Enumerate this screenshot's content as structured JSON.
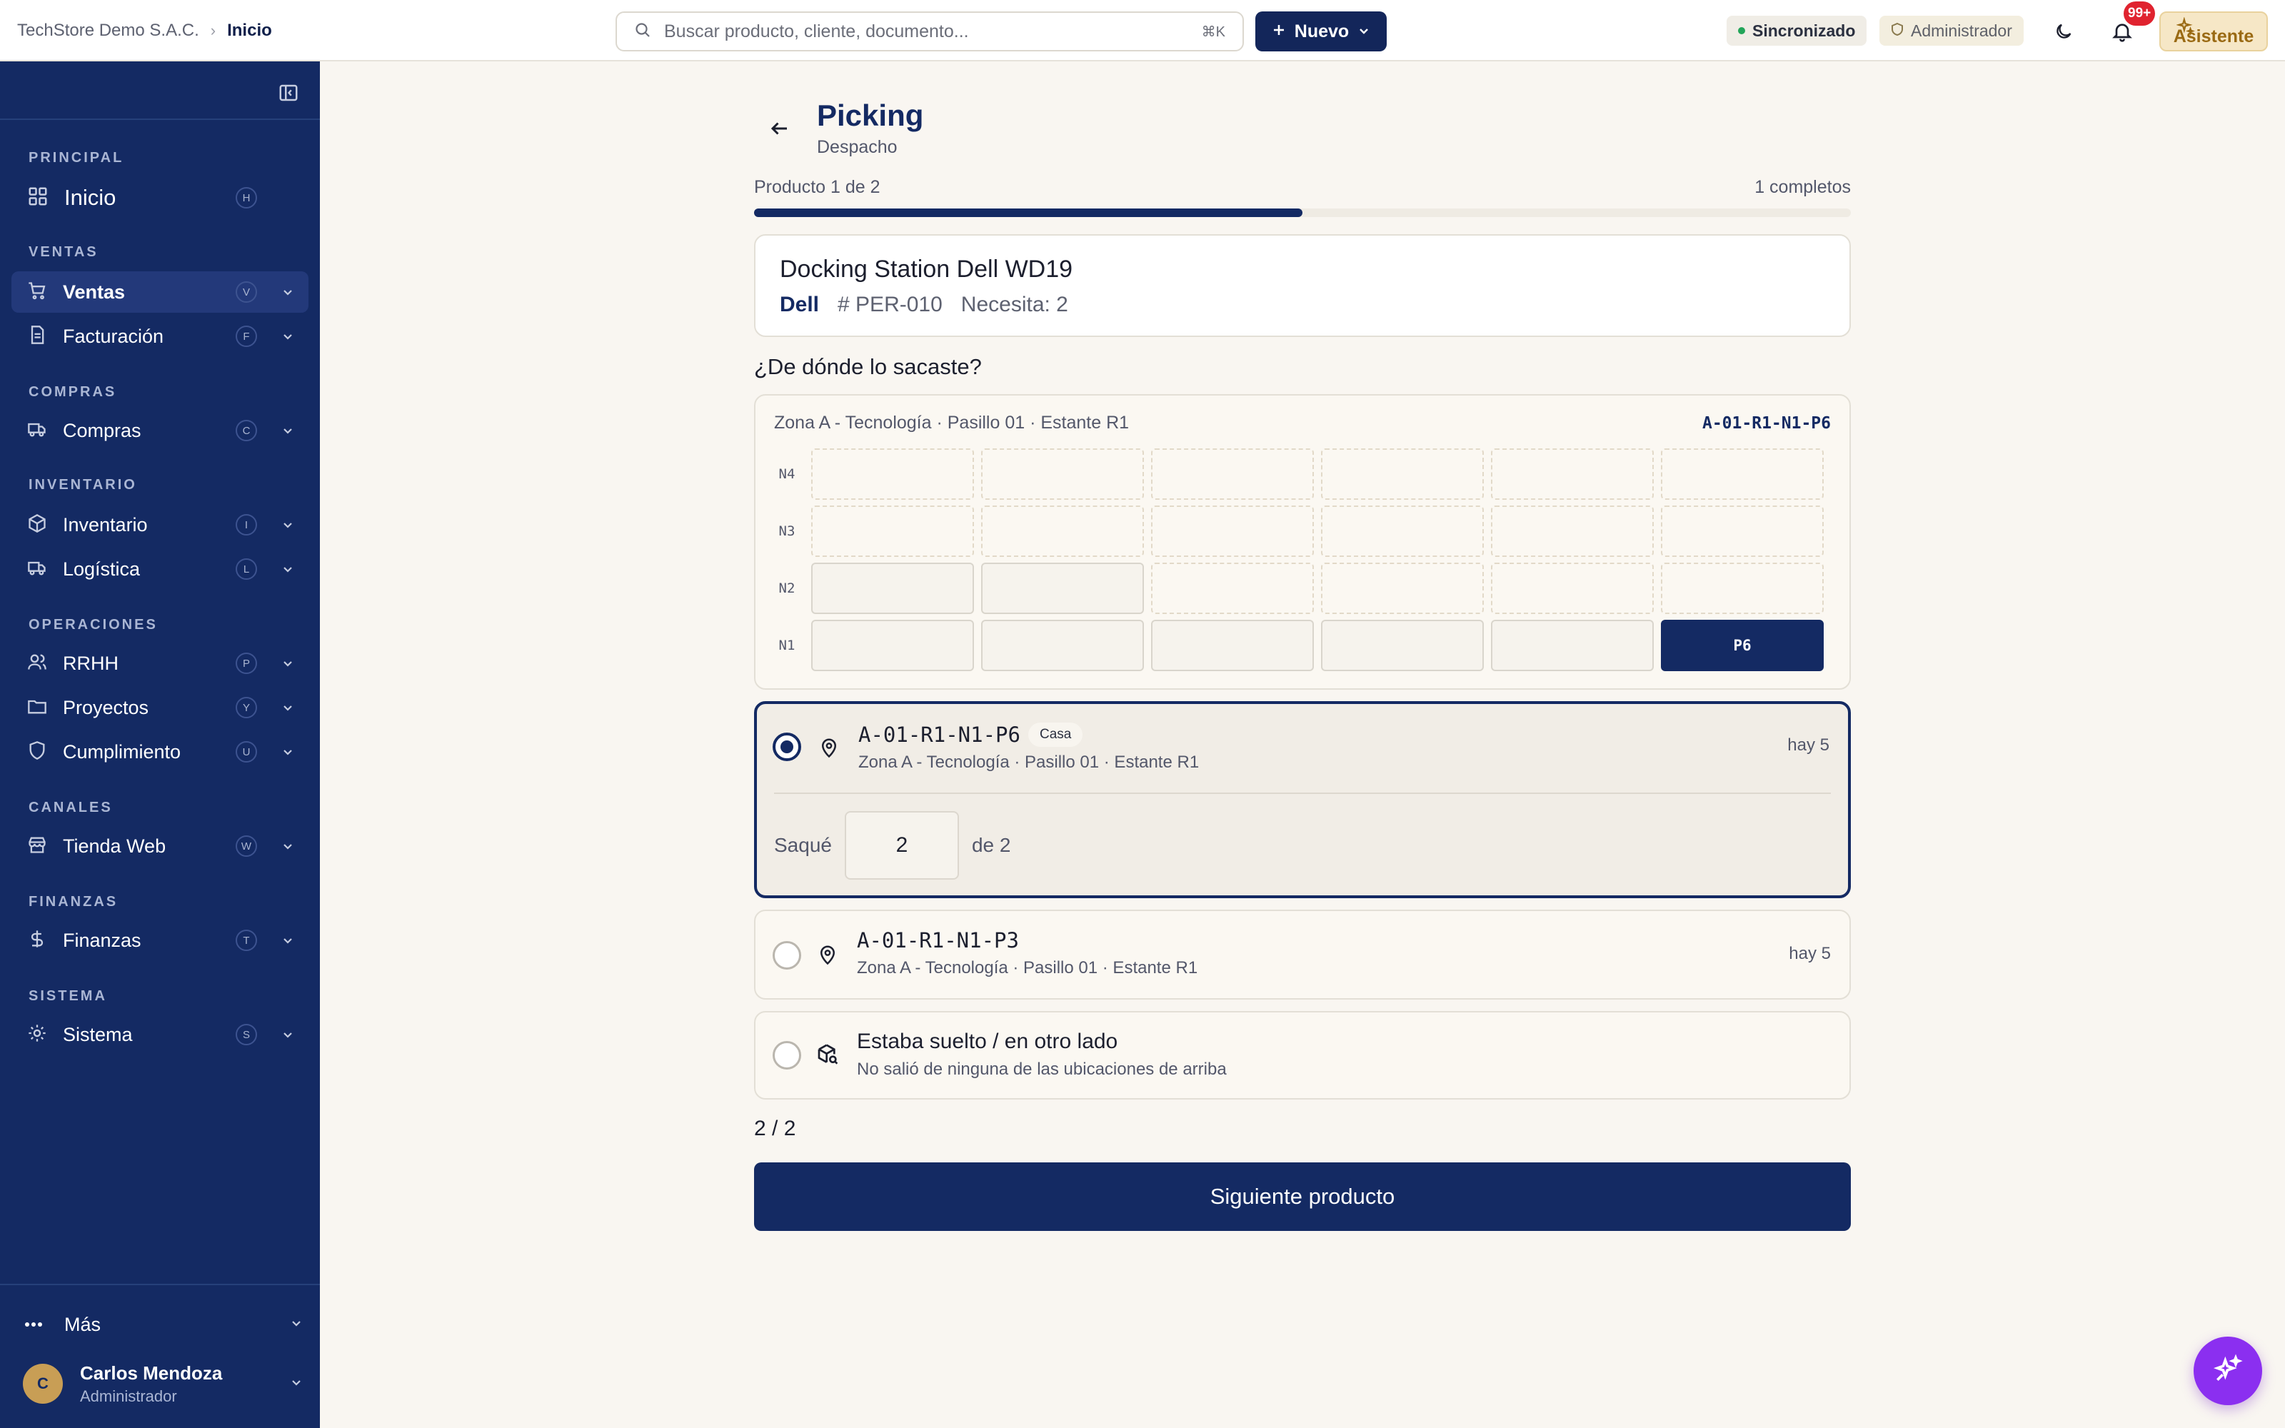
{
  "header": {
    "company": "TechStore Demo S.A.C.",
    "breadcrumb_current": "Inicio",
    "search_placeholder": "Buscar producto, cliente, documento...",
    "search_shortcut": "⌘K",
    "new_button": "Nuevo",
    "sync_status": "Sincronizado",
    "role_badge": "Administrador",
    "notifications_count": "99+",
    "assistant_button": "Asistente"
  },
  "sidebar": {
    "sections": {
      "principal": "PRINCIPAL",
      "ventas": "VENTAS",
      "compras": "COMPRAS",
      "inventario": "INVENTARIO",
      "operaciones": "OPERACIONES",
      "canales": "CANALES",
      "finanzas": "FINANZAS",
      "sistema": "SISTEMA"
    },
    "items": [
      {
        "label": "Inicio",
        "key": "H"
      },
      {
        "label": "Ventas",
        "key": "V"
      },
      {
        "label": "Facturación",
        "key": "F"
      },
      {
        "label": "Compras",
        "key": "C"
      },
      {
        "label": "Inventario",
        "key": "I"
      },
      {
        "label": "Logística",
        "key": "L"
      },
      {
        "label": "RRHH",
        "key": "P"
      },
      {
        "label": "Proyectos",
        "key": "Y"
      },
      {
        "label": "Cumplimiento",
        "key": "U"
      },
      {
        "label": "Tienda Web",
        "key": "W"
      },
      {
        "label": "Finanzas",
        "key": "T"
      },
      {
        "label": "Sistema",
        "key": "S"
      }
    ],
    "more": "Más",
    "user": {
      "initial": "C",
      "name": "Carlos Mendoza",
      "role": "Administrador"
    }
  },
  "page": {
    "title": "Picking",
    "subtitle": "Despacho",
    "progress_label": "Producto 1 de 2",
    "completed_label": "1 completos",
    "progress_fraction": 0.5
  },
  "product": {
    "name": "Docking Station Dell WD19",
    "brand": "Dell",
    "sku": "# PER-010",
    "needs": "Necesita: 2"
  },
  "question": "¿De dónde lo sacaste?",
  "rack": {
    "location": "Zona A - Tecnología · Pasillo 01 · Estante R1",
    "code": "A-01-R1-N1-P6",
    "levels": [
      "N4",
      "N3",
      "N2",
      "N1"
    ],
    "selected_slot": "P6"
  },
  "options": [
    {
      "code": "A-01-R1-N1-P6",
      "tag": "Casa",
      "location": "Zona A - Tecnología · Pasillo 01 · Estante R1",
      "stock": "hay 5",
      "picked_label": "Saqué",
      "picked_value": "2",
      "of_label": "de 2"
    },
    {
      "code": "A-01-R1-N1-P3",
      "location": "Zona A - Tecnología · Pasillo 01 · Estante R1",
      "stock": "hay 5"
    },
    {
      "title": "Estaba suelto / en otro lado",
      "subtitle": "No salió de ninguna de las ubicaciones de arriba"
    }
  ],
  "counter": "2 / 2",
  "next_button": "Siguiente producto",
  "colors": {
    "primary": "#142a63",
    "background": "#f9f6f1",
    "assistant_fab": "#8b2ff0",
    "sync_dot": "#22a559",
    "notification_badge": "#e0232f"
  }
}
